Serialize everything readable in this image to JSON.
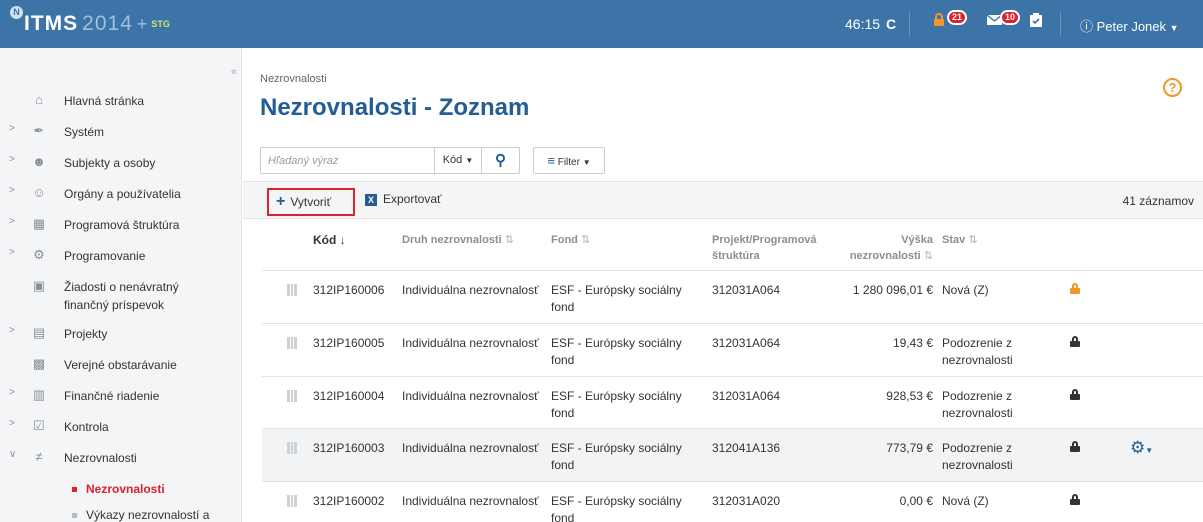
{
  "header": {
    "logo_letters": "ITMS",
    "logo_year": "2014",
    "logo_plus": "+",
    "logo_env": "STG",
    "timer": "46:15",
    "timer_icon": "C",
    "lock_badge": "21",
    "mail_badge": "10",
    "user_name": "Peter Jonek"
  },
  "sidebar": {
    "items": [
      {
        "label": "Hlavná stránka",
        "icon": "home-icon"
      },
      {
        "label": "Systém",
        "icon": "wrench-icon"
      },
      {
        "label": "Subjekty a osoby",
        "icon": "people-icon"
      },
      {
        "label": "Orgány a používatelia",
        "icon": "users-icon"
      },
      {
        "label": "Programová štruktúra",
        "icon": "hierarchy-icon"
      },
      {
        "label": "Programovanie",
        "icon": "gears-icon"
      },
      {
        "label": "Žiadosti o nenávratný finančný príspevok",
        "icon": "document-icon"
      },
      {
        "label": "Projekty",
        "icon": "projects-icon"
      },
      {
        "label": "Verejné obstarávanie",
        "icon": "cart-icon"
      },
      {
        "label": "Finančné riadenie",
        "icon": "finance-icon"
      },
      {
        "label": "Kontrola",
        "icon": "check-icon"
      },
      {
        "label": "Nezrovnalosti",
        "icon": "not-equal-icon"
      }
    ],
    "subitems": [
      {
        "label": "Nezrovnalosti"
      },
      {
        "label": "Výkazy nezrovnalostí a"
      }
    ]
  },
  "page": {
    "breadcrumb": "Nezrovnalosti",
    "title": "Nezrovnalosti - Zoznam",
    "help": "?"
  },
  "search": {
    "placeholder": "Hľadaný výraz",
    "field": "Kód",
    "filter_label": "Filter"
  },
  "toolbar": {
    "create_label": "Vytvoriť",
    "export_label": "Exportovať",
    "count": "41 záznamov"
  },
  "table": {
    "headers": {
      "kod": "Kód",
      "druh": "Druh nezrovnalosti",
      "fond": "Fond",
      "projekt": "Projekt/Programová štruktúra",
      "vyska": "Výška nezrovnalosti",
      "stav": "Stav"
    },
    "rows": [
      {
        "kod": "312IP160006",
        "druh": "Individuálna nezrovnalosť",
        "fond": "ESF - Európsky sociálny fond",
        "projekt": "312031A064",
        "vyska": "1 280 096,01 €",
        "stav": "Nová (Z)",
        "lock": "orange"
      },
      {
        "kod": "312IP160005",
        "druh": "Individuálna nezrovnalosť",
        "fond": "ESF - Európsky sociálny fond",
        "projekt": "312031A064",
        "vyska": "19,43 €",
        "stav": "Podozrenie z nezrovnalosti",
        "lock": "black"
      },
      {
        "kod": "312IP160004",
        "druh": "Individuálna nezrovnalosť",
        "fond": "ESF - Európsky sociálny fond",
        "projekt": "312031A064",
        "vyska": "928,53 €",
        "stav": "Podozrenie z nezrovnalosti",
        "lock": "black"
      },
      {
        "kod": "312IP160003",
        "druh": "Individuálna nezrovnalosť",
        "fond": "ESF - Európsky sociálny fond",
        "projekt": "312041A136",
        "vyska": "773,79 €",
        "stav": "Podozrenie z nezrovnalosti",
        "lock": "black"
      },
      {
        "kod": "312IP160002",
        "druh": "Individuálna nezrovnalosť",
        "fond": "ESF - Európsky sociálny fond",
        "projekt": "312031A020",
        "vyska": "0,00 €",
        "stav": "Nová (Z)",
        "lock": "black"
      }
    ]
  },
  "colors": {
    "header_bg": "#3c74a8",
    "title": "#245d93",
    "accent_red": "#d9232d",
    "accent_orange": "#f0962a"
  }
}
